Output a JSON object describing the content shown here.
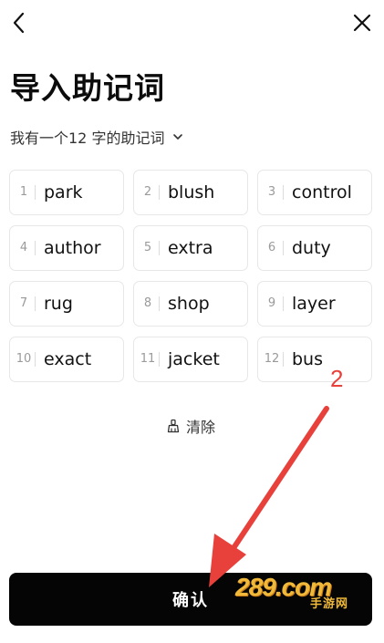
{
  "header": {
    "back_icon": "chevron-left-icon",
    "close_icon": "close-icon",
    "title": "导入助记词"
  },
  "selector": {
    "label": "我有一个12 字的助记词",
    "icon": "chevron-down-icon"
  },
  "words": [
    {
      "num": "1",
      "word": "park"
    },
    {
      "num": "2",
      "word": "blush"
    },
    {
      "num": "3",
      "word": "control"
    },
    {
      "num": "4",
      "word": "author"
    },
    {
      "num": "5",
      "word": "extra"
    },
    {
      "num": "6",
      "word": "duty"
    },
    {
      "num": "7",
      "word": "rug"
    },
    {
      "num": "8",
      "word": "shop"
    },
    {
      "num": "9",
      "word": "layer"
    },
    {
      "num": "10",
      "word": "exact"
    },
    {
      "num": "11",
      "word": "jacket"
    },
    {
      "num": "12",
      "word": "bus"
    }
  ],
  "clear": {
    "label": "清除",
    "icon": "broom-icon"
  },
  "confirm": {
    "label": "确认"
  },
  "annotation": {
    "step": "2",
    "color": "#e8403a"
  },
  "watermark": {
    "main": "289.com",
    "sub": "手游网"
  },
  "colors": {
    "primary_button": "#050505",
    "cell_border": "#e7e7e7"
  }
}
